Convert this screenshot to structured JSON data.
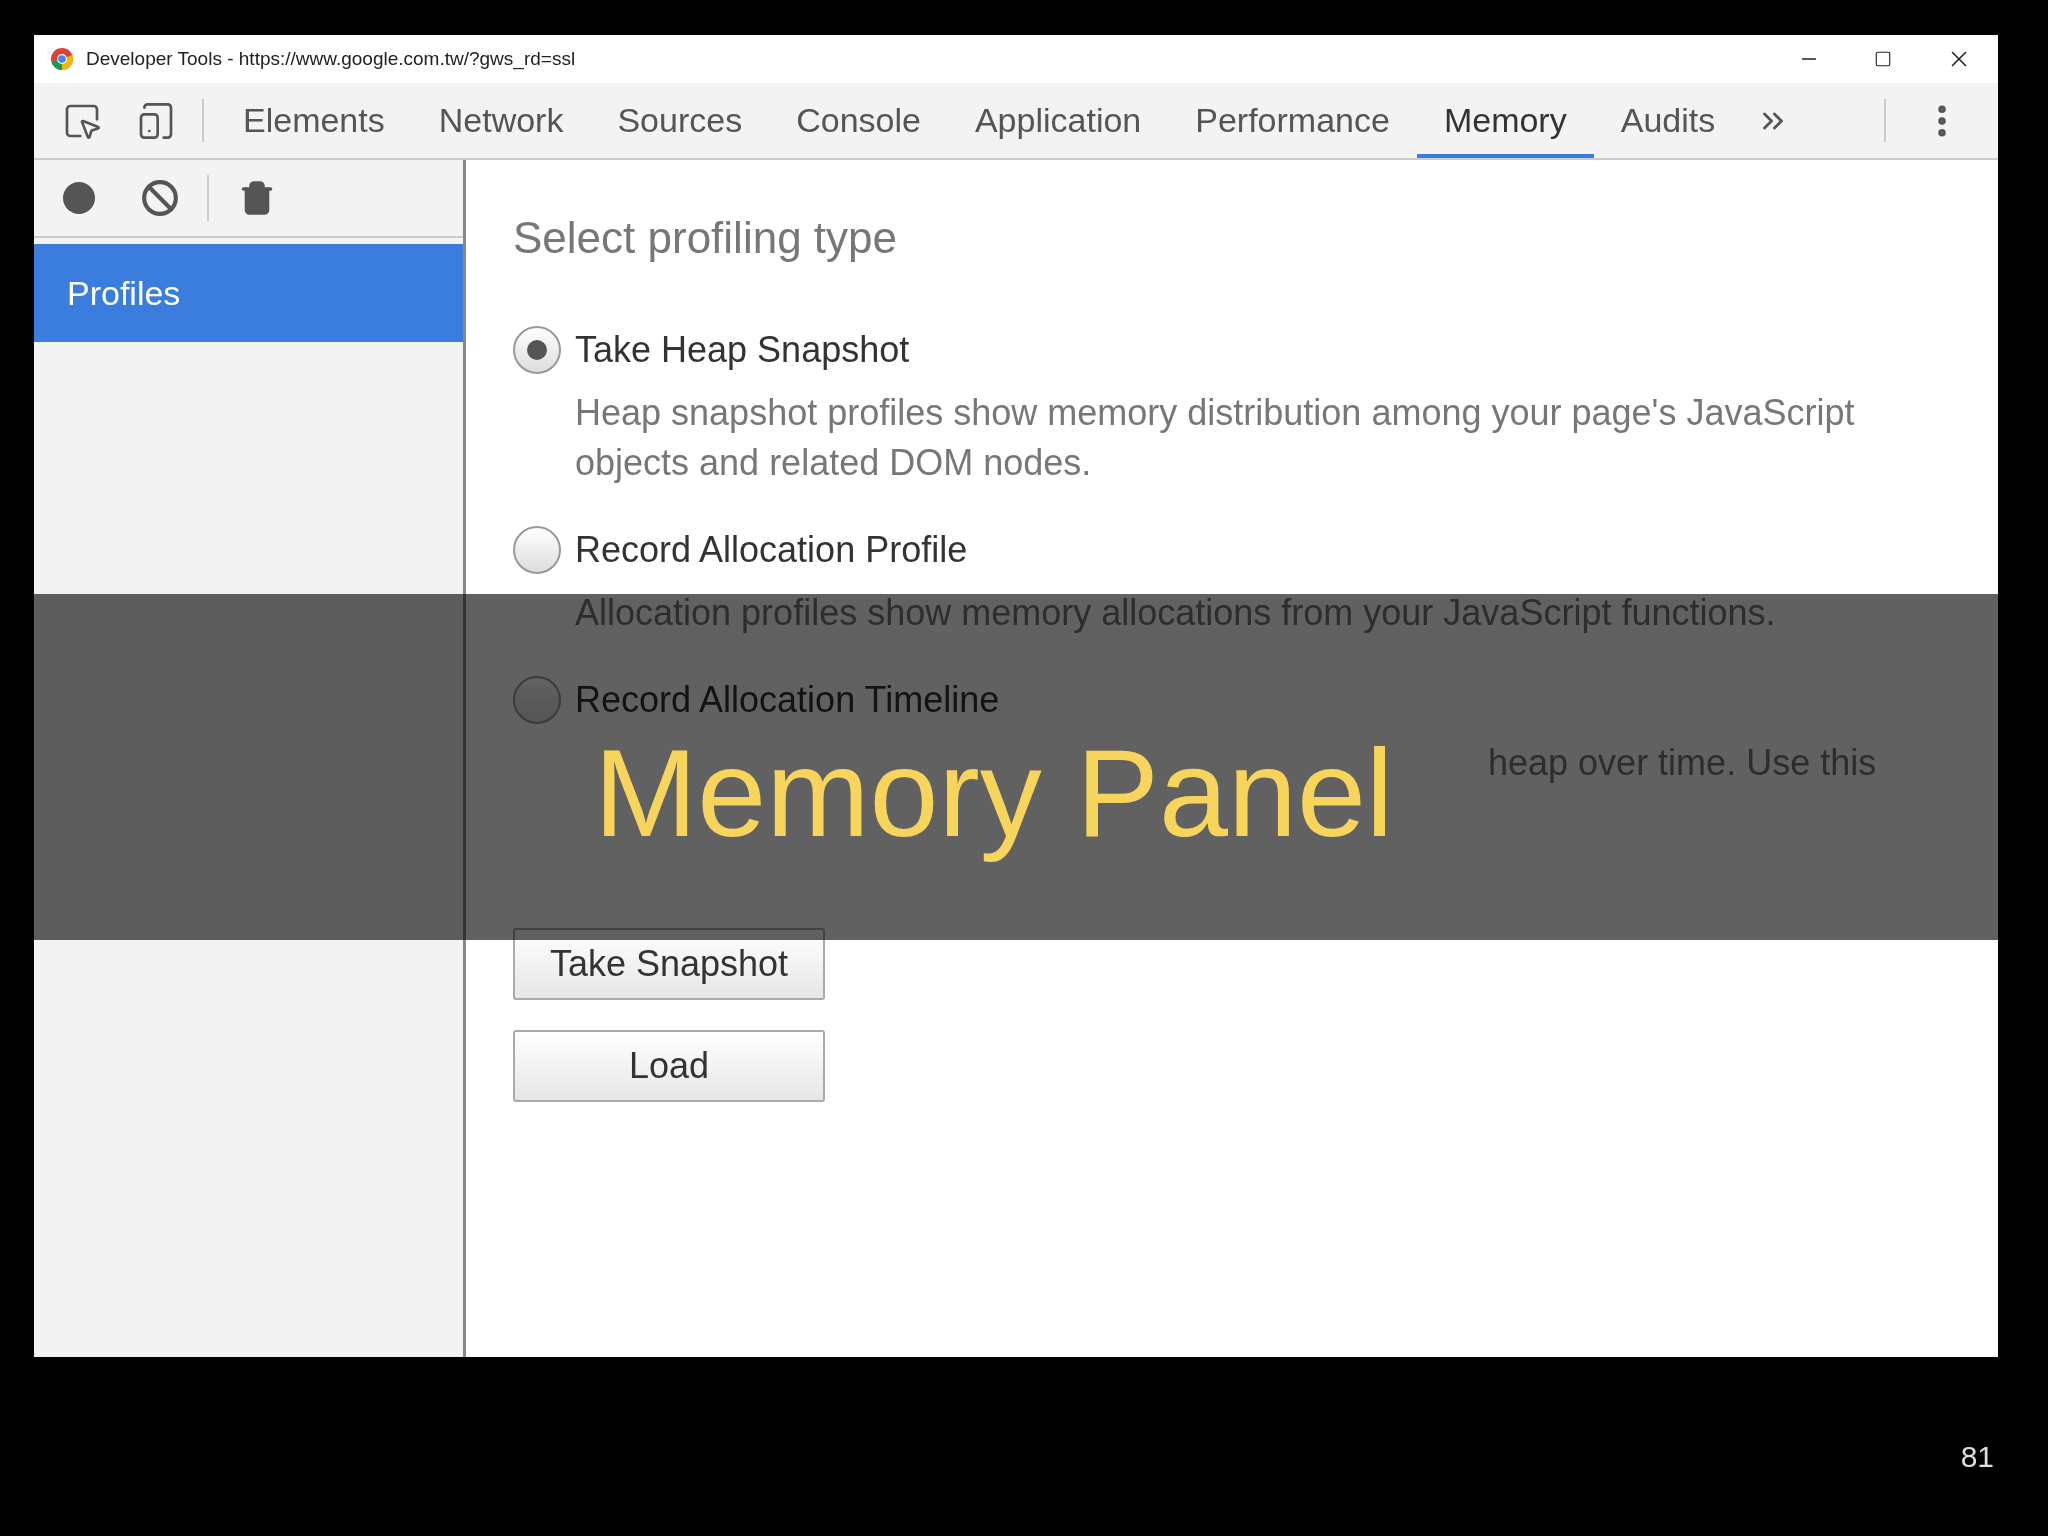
{
  "window": {
    "title": "Developer Tools - https://www.google.com.tw/?gws_rd=ssl"
  },
  "tabs": [
    {
      "label": "Elements",
      "selected": false
    },
    {
      "label": "Network",
      "selected": false
    },
    {
      "label": "Sources",
      "selected": false
    },
    {
      "label": "Console",
      "selected": false
    },
    {
      "label": "Application",
      "selected": false
    },
    {
      "label": "Performance",
      "selected": false
    },
    {
      "label": "Memory",
      "selected": true
    },
    {
      "label": "Audits",
      "selected": false
    }
  ],
  "sidebar": {
    "items": [
      {
        "label": "Profiles",
        "selected": true
      }
    ]
  },
  "profiling": {
    "heading": "Select profiling type",
    "options": [
      {
        "label": "Take Heap Snapshot",
        "description": "Heap snapshot profiles show memory distribution among your page's JavaScript objects and related DOM nodes.",
        "selected": true
      },
      {
        "label": "Record Allocation Profile",
        "description": "Allocation profiles show memory allocations from your JavaScript functions.",
        "selected": false
      },
      {
        "label": "Record Allocation Timeline",
        "description": "heap over time. Use this",
        "covered": true,
        "selected": false
      }
    ]
  },
  "buttons": [
    "Take Snapshot",
    "Load"
  ],
  "slide": {
    "title": "Memory Panel",
    "page_number": "81"
  }
}
